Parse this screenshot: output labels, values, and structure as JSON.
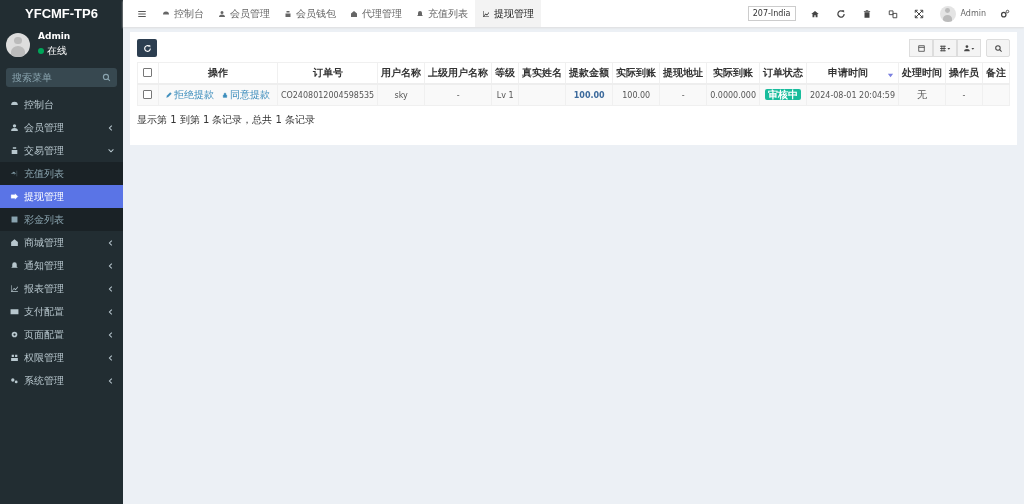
{
  "brand": {
    "title": "YFCMF-TP6"
  },
  "user_panel": {
    "name": "Admin",
    "status": "在线",
    "online": true
  },
  "sidebar": {
    "search": {
      "placeholder": "搜索菜单"
    },
    "items": [
      {
        "label": "控制台",
        "selected": false
      },
      {
        "label": "会员管理",
        "selected": false,
        "expanded": false
      },
      {
        "label": "交易管理",
        "selected": false,
        "expanded": true,
        "children": [
          {
            "label": "充值列表",
            "selected": false
          },
          {
            "label": "提现管理",
            "selected": true
          },
          {
            "label": "彩金列表",
            "selected": false
          }
        ]
      },
      {
        "label": "商城管理",
        "selected": false,
        "expanded": false
      },
      {
        "label": "通知管理",
        "selected": false,
        "expanded": false
      },
      {
        "label": "报表管理",
        "selected": false,
        "expanded": false
      },
      {
        "label": "支付配置",
        "selected": false,
        "expanded": false
      },
      {
        "label": "页面配置",
        "selected": false,
        "expanded": false
      },
      {
        "label": "权限管理",
        "selected": false,
        "expanded": false
      },
      {
        "label": "系统管理",
        "selected": false,
        "expanded": false
      }
    ]
  },
  "top_tabs": [
    {
      "label": "控制台",
      "selected": false
    },
    {
      "label": "会员管理",
      "selected": false
    },
    {
      "label": "会员钱包",
      "selected": false
    },
    {
      "label": "代理管理",
      "selected": false
    },
    {
      "label": "充值列表",
      "selected": false
    },
    {
      "label": "提现管理",
      "selected": true
    }
  ],
  "top_right": {
    "region": "207-India",
    "user": "Admin"
  },
  "table": {
    "columns": [
      {
        "label": "操作",
        "sorted": false
      },
      {
        "label": "订单号",
        "sorted": false
      },
      {
        "label": "用户名称",
        "sorted": false
      },
      {
        "label": "上级用户名称",
        "sorted": false
      },
      {
        "label": "等级",
        "sorted": false
      },
      {
        "label": "真实姓名",
        "sorted": false
      },
      {
        "label": "提款金额",
        "sorted": false
      },
      {
        "label": "实际到账",
        "sorted": false
      },
      {
        "label": "提现地址",
        "sorted": false
      },
      {
        "label": "实际到账",
        "sorted": false
      },
      {
        "label": "订单状态",
        "sorted": false
      },
      {
        "label": "申请时间",
        "sorted": true
      },
      {
        "label": "处理时间",
        "sorted": false
      },
      {
        "label": "操作员",
        "sorted": false
      },
      {
        "label": "备注",
        "sorted": false
      }
    ],
    "header_checked": false,
    "rows": [
      {
        "checked": false,
        "actions": [
          {
            "label": "拒绝提款",
            "kind": "reject"
          },
          {
            "label": "同意提款",
            "kind": "approve"
          }
        ],
        "order_no": "CO2408012004598535",
        "username": "sky",
        "parent": "-",
        "level": "Lv 1",
        "real_name": "",
        "amount": "100.00",
        "received": "100.00",
        "address": "-",
        "actual": "0.0000.000",
        "status": "审核中",
        "applied": "2024-08-01 20:04:59",
        "processed": "无",
        "operator": "-",
        "remark": ""
      }
    ]
  },
  "pagination": {
    "summary": "显示第 1 到第 1 条记录，总共 1 条记录"
  }
}
